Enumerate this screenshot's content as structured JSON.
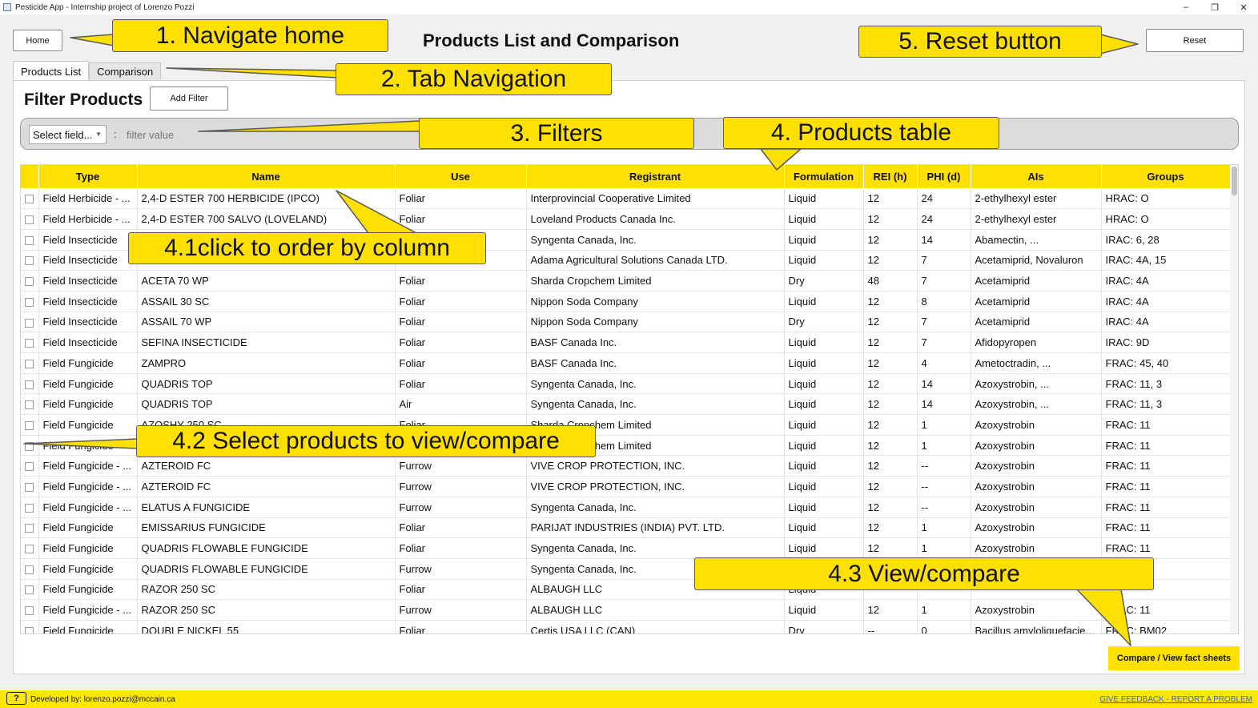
{
  "window": {
    "title": "Pesticide App - Internship project of Lorenzo Pozzi",
    "controls": [
      "–",
      "❐",
      "✕"
    ]
  },
  "header": {
    "home_label": "Home",
    "title": "Products List and Comparison",
    "reset_label": "Reset"
  },
  "tabs": [
    {
      "label": "Products List",
      "active": true
    },
    {
      "label": "Comparison",
      "active": false
    }
  ],
  "filters": {
    "heading": "Filter Products",
    "add_filter_label": "Add Filter",
    "field_select": "Select field...",
    "separator": ":",
    "value_placeholder": "filter value"
  },
  "table": {
    "columns": [
      "",
      "Type",
      "Name",
      "Use",
      "Registrant",
      "Formulation",
      "REI (h)",
      "PHI (d)",
      "AIs",
      "Groups"
    ],
    "rows": [
      [
        "Field Herbicide - ...",
        "2,4-D ESTER 700 HERBICIDE (IPCO)",
        "Foliar",
        "Interprovincial Cooperative Limited",
        "Liquid",
        "12",
        "24",
        "2-ethylhexyl ester",
        "HRAC: O"
      ],
      [
        "Field Herbicide - ...",
        "2,4-D ESTER 700 SALVO (LOVELAND)",
        "Foliar",
        "Loveland Products Canada Inc.",
        "Liquid",
        "12",
        "24",
        "2-ethylhexyl ester",
        "HRAC: O"
      ],
      [
        "Field Insecticide",
        "",
        "",
        "Syngenta Canada, Inc.",
        "Liquid",
        "12",
        "14",
        "Abamectin, ...",
        "IRAC: 6, 28"
      ],
      [
        "Field Insecticide",
        "",
        "",
        "Adama Agricultural Solutions Canada LTD.",
        "Liquid",
        "12",
        "7",
        "Acetamiprid, Novaluron",
        "IRAC: 4A, 15"
      ],
      [
        "Field Insecticide",
        "ACETA 70 WP",
        "Foliar",
        "Sharda Cropchem Limited",
        "Dry",
        "48",
        "7",
        "Acetamiprid",
        "IRAC: 4A"
      ],
      [
        "Field Insecticide",
        "ASSAIL 30 SC",
        "Foliar",
        "Nippon Soda Company",
        "Liquid",
        "12",
        "8",
        "Acetamiprid",
        "IRAC: 4A"
      ],
      [
        "Field Insecticide",
        "ASSAIL 70 WP",
        "Foliar",
        "Nippon Soda Company",
        "Dry",
        "12",
        "7",
        "Acetamiprid",
        "IRAC: 4A"
      ],
      [
        "Field Insecticide",
        "SEFINA INSECTICIDE",
        "Foliar",
        "BASF Canada Inc.",
        "Liquid",
        "12",
        "7",
        "Afidopyropen",
        "IRAC: 9D"
      ],
      [
        "Field Fungicide",
        "ZAMPRO",
        "Foliar",
        "BASF Canada Inc.",
        "Liquid",
        "12",
        "4",
        "Ametoctradin, ...",
        "FRAC: 45, 40"
      ],
      [
        "Field Fungicide",
        "QUADRIS TOP",
        "Foliar",
        "Syngenta Canada, Inc.",
        "Liquid",
        "12",
        "14",
        "Azoxystrobin, ...",
        "FRAC: 11, 3"
      ],
      [
        "Field Fungicide",
        "QUADRIS TOP",
        "Air",
        "Syngenta Canada, Inc.",
        "Liquid",
        "12",
        "14",
        "Azoxystrobin, ...",
        "FRAC: 11, 3"
      ],
      [
        "Field Fungicide",
        "AZOSHY 250 SC",
        "Foliar",
        "Sharda Cropchem Limited",
        "Liquid",
        "12",
        "1",
        "Azoxystrobin",
        "FRAC: 11"
      ],
      [
        "Field Fungicide",
        "",
        "",
        "Sharda Cropchem Limited",
        "Liquid",
        "12",
        "1",
        "Azoxystrobin",
        "FRAC: 11"
      ],
      [
        "Field Fungicide - ...",
        "AZTEROID FC",
        "Furrow",
        "VIVE CROP PROTECTION, INC.",
        "Liquid",
        "12",
        "--",
        "Azoxystrobin",
        "FRAC: 11"
      ],
      [
        "Field Fungicide - ...",
        "AZTEROID FC",
        "Furrow",
        "VIVE CROP PROTECTION, INC.",
        "Liquid",
        "12",
        "--",
        "Azoxystrobin",
        "FRAC: 11"
      ],
      [
        "Field Fungicide - ...",
        "ELATUS A FUNGICIDE",
        "Furrow",
        "Syngenta Canada, Inc.",
        "Liquid",
        "12",
        "--",
        "Azoxystrobin",
        "FRAC: 11"
      ],
      [
        "Field Fungicide",
        "EMISSARIUS FUNGICIDE",
        "Foliar",
        "PARIJAT INDUSTRIES (INDIA) PVT. LTD.",
        "Liquid",
        "12",
        "1",
        "Azoxystrobin",
        "FRAC: 11"
      ],
      [
        "Field Fungicide",
        "QUADRIS FLOWABLE FUNGICIDE",
        "Foliar",
        "Syngenta Canada, Inc.",
        "Liquid",
        "12",
        "1",
        "Azoxystrobin",
        "FRAC: 11"
      ],
      [
        "Field Fungicide",
        "QUADRIS FLOWABLE FUNGICIDE",
        "Furrow",
        "Syngenta Canada, Inc.",
        "",
        "",
        "",
        "",
        ""
      ],
      [
        "Field Fungicide",
        "RAZOR 250 SC",
        "Foliar",
        "ALBAUGH LLC",
        "Liquid",
        "",
        "",
        "",
        ""
      ],
      [
        "Field Fungicide - ...",
        "RAZOR 250 SC",
        "Furrow",
        "ALBAUGH LLC",
        "Liquid",
        "12",
        "1",
        "Azoxystrobin",
        "FRAC: 11"
      ],
      [
        "Field Fungicide",
        "DOUBLE NICKEL 55",
        "Foliar",
        "Certis USA LLC (CAN)",
        "Dry",
        "--",
        "0",
        "Bacillus amyloliquefacie...",
        "FRAC: BM02"
      ]
    ]
  },
  "compare_label": "Compare / View fact sheets",
  "footer": {
    "help": "?",
    "developer": "Developed by: lorenzo.pozzi@mccain.ca",
    "feedback": "GIVE FEEDBACK - REPORT A PROBLEM"
  },
  "annotations": {
    "a1": "1. Navigate home",
    "a2": "2. Tab Navigation",
    "a3": "3. Filters",
    "a4": "4. Products table",
    "a41": "4.1click to order by column",
    "a42": "4.2 Select products to view/compare",
    "a43": "4.3 View/compare",
    "a5": "5. Reset button"
  },
  "colors": {
    "accent": "#ffe000",
    "footer": "#ffe800",
    "link": "#4060c0"
  }
}
